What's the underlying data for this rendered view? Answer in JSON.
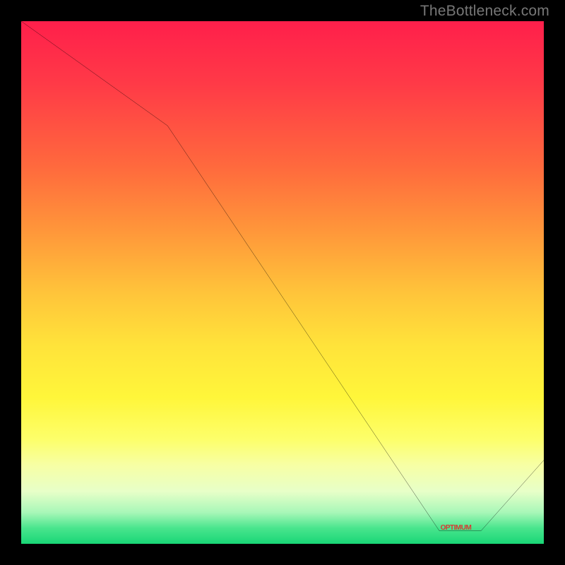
{
  "watermark": "TheBottleneck.com",
  "floor_label": "OPTIMUM",
  "chart_data": {
    "type": "line",
    "title": "",
    "xlabel": "",
    "ylabel": "",
    "xlim": [
      0,
      100
    ],
    "ylim": [
      0,
      100
    ],
    "x": [
      0,
      28,
      80,
      88,
      100
    ],
    "values": [
      100,
      80,
      2.5,
      2.5,
      16
    ],
    "optimum_range_x": [
      80,
      88
    ],
    "background_gradient": {
      "top": "#ff1f4b",
      "bottom": "#19d676"
    },
    "line_color": "#000000"
  }
}
